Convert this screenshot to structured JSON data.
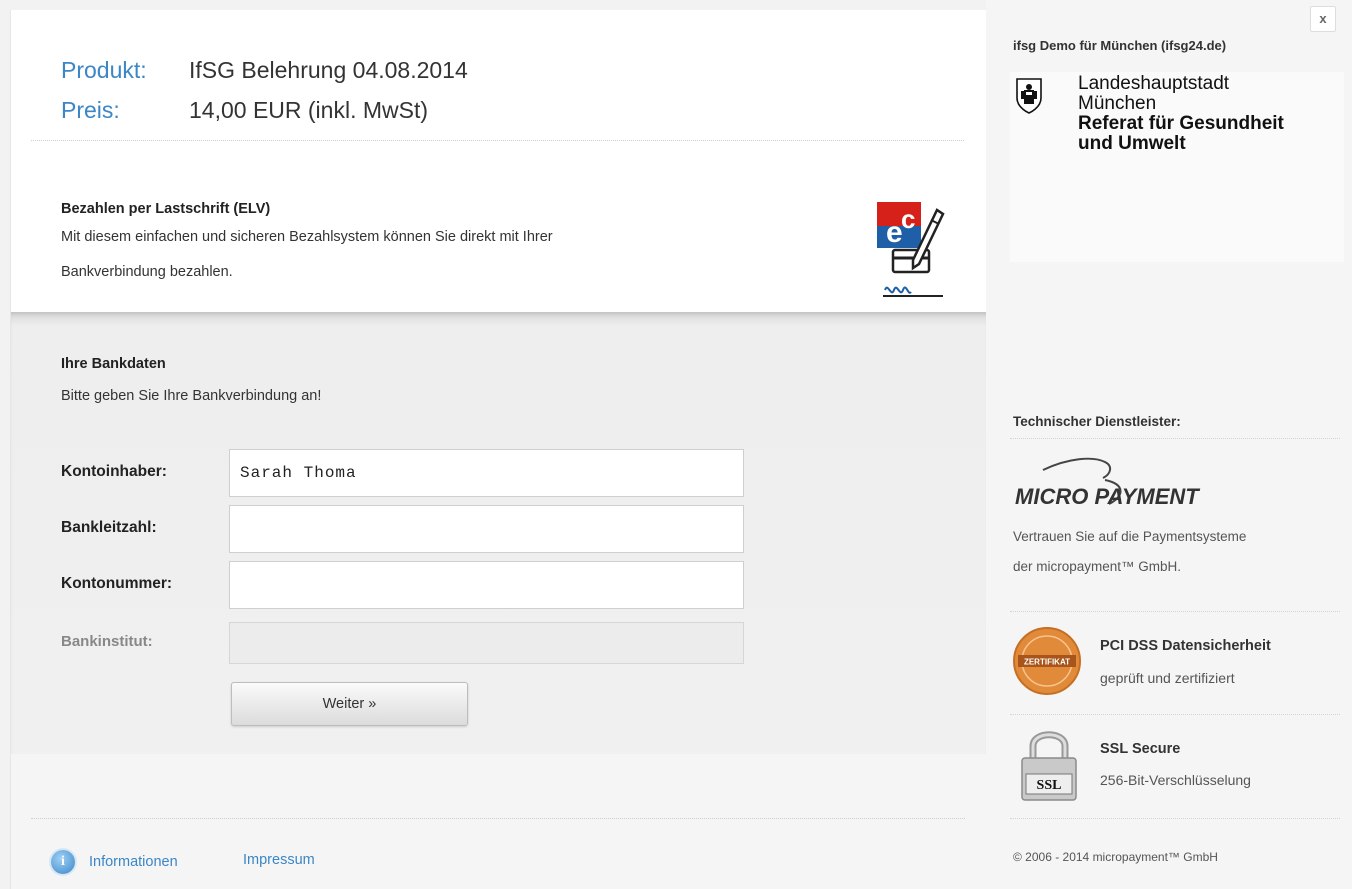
{
  "product": {
    "product_label": "Produkt:",
    "product_value": "IfSG Belehrung 04.08.2014",
    "price_label": "Preis:",
    "price_value": "14,00 EUR (inkl. MwSt)"
  },
  "payment": {
    "title": "Bezahlen per Lastschrift (ELV)",
    "text_line1": "Mit diesem einfachen und sicheren Bezahlsystem können Sie direkt mit Ihrer",
    "text_line2": "Bankverbindung bezahlen.",
    "logo_icon": "ec-lastschrift-icon"
  },
  "bank": {
    "title": "Ihre Bankdaten",
    "subtitle": "Bitte geben Sie Ihre Bankverbindung an!",
    "fields": {
      "owner": {
        "label": "Kontoinhaber:",
        "value": "Sarah Thoma"
      },
      "blz": {
        "label": "Bankleitzahl:",
        "value": ""
      },
      "account": {
        "label": "Kontonummer:",
        "value": ""
      },
      "institute": {
        "label": "Bankinstitut:",
        "value": ""
      }
    },
    "submit_label": "Weiter »"
  },
  "footer": {
    "info_label": "Informationen",
    "imprint_label": "Impressum"
  },
  "sidebar": {
    "close_label": "x",
    "merchant": "ifsg Demo für München (ifsg24.de)",
    "city_line1": "Landeshauptstadt",
    "city_line2": "München",
    "dept_line1": "Referat für Gesundheit",
    "dept_line2": "und Umwelt",
    "tech_title": "Technischer Dienstleister:",
    "micropayment_logo": "MICRO PAYMENT",
    "trust_line1": "Vertrauen Sie auf die Paymentsysteme",
    "trust_line2": "der micropayment™ GmbH.",
    "pci_badge_text": "ZERTIFIKAT",
    "pci_title": "PCI DSS Datensicherheit",
    "pci_sub": "geprüft und zertifiziert",
    "ssl_lock_text": "SSL",
    "ssl_title": "SSL Secure",
    "ssl_sub": "256-Bit-Verschlüsselung",
    "copyright": "© 2006 - 2014 micropayment™ GmbH"
  },
  "colors": {
    "link_blue": "#3b86c6",
    "ec_red": "#d6201a",
    "ec_blue": "#1e5fa8",
    "badge_orange": "#e08a3a"
  }
}
